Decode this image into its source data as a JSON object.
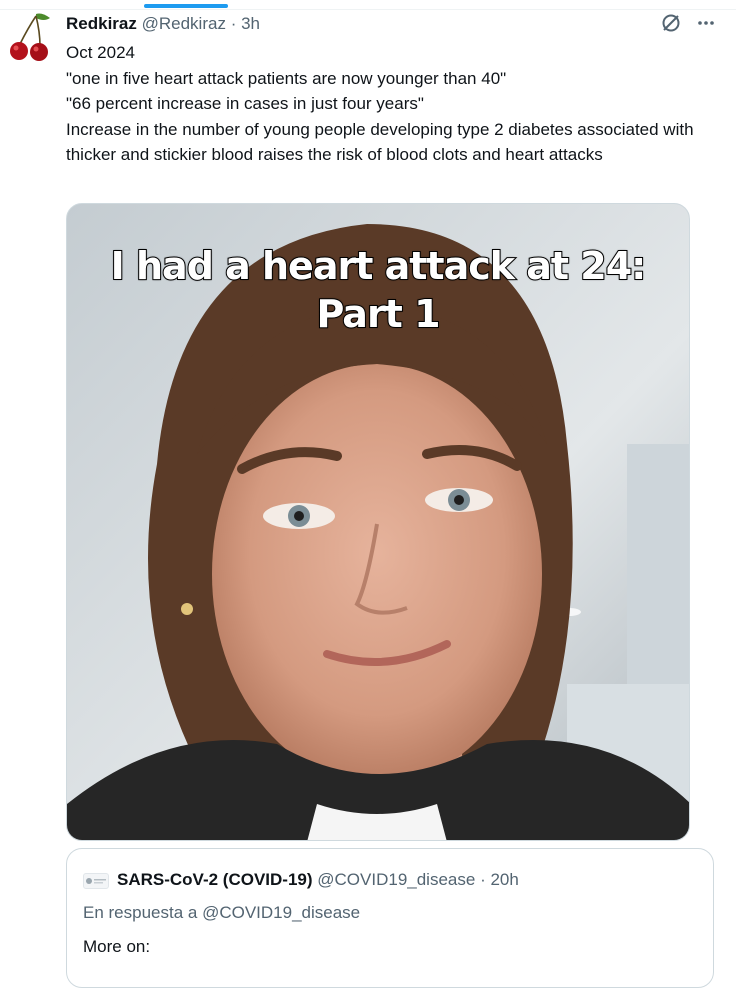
{
  "tweet": {
    "author_name": "Redkiraz",
    "author_handle": "@Redkiraz",
    "separator": "·",
    "time": "3h",
    "text_lines": [
      "Oct 2024",
      "\"one in five heart attack patients are now younger than 40\"",
      "\"66 percent increase in cases in just four years\"",
      "Increase in the number of young people developing type 2 diabetes associated with thicker and stickier blood raises the risk of blood clots and heart attacks"
    ],
    "avatar_icon": "cherries-icon",
    "actions": [
      "grok-icon",
      "more-icon"
    ],
    "more_label": "···"
  },
  "media": {
    "overlay_line1": "I had a heart attack at 24:",
    "overlay_line2": "Part 1"
  },
  "quote": {
    "author_name": "SARS-CoV-2 (COVID-19)",
    "author_handle": "@COVID19_disease",
    "separator": "·",
    "time": "20h",
    "reply_to": "En respuesta a @COVID19_disease",
    "body": "More on:"
  },
  "colors": {
    "text": "#0f1419",
    "muted": "#536471",
    "border": "#cfd9de",
    "accent": "#1d9bf0"
  }
}
